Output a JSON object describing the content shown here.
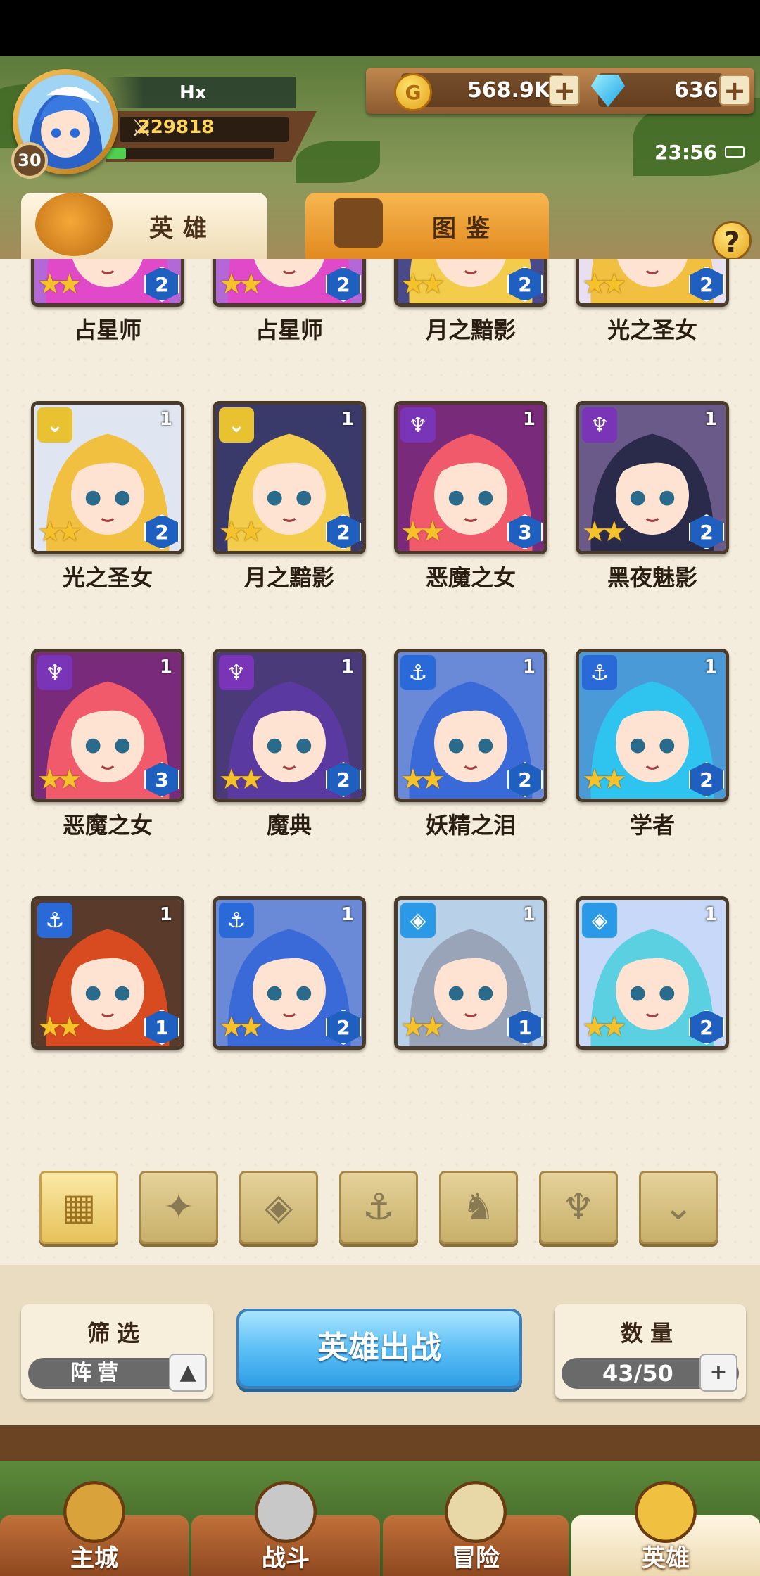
{
  "player": {
    "name": "Hx",
    "level": "30",
    "power": "229818",
    "exp_fraction": 0.12
  },
  "currency": {
    "gold": "568.9K",
    "gems": "636",
    "gold_symbol": "G"
  },
  "status": {
    "time": "23:56"
  },
  "tabs": {
    "heroes": "英雄",
    "codex": "图鉴",
    "help": "?"
  },
  "heroes": [
    {
      "name": "占星师",
      "faction": "light",
      "count": "",
      "stars": 2,
      "tier": "2",
      "hair": "#e04ac8",
      "bg": "#b468d8"
    },
    {
      "name": "占星师",
      "faction": "light",
      "count": "",
      "stars": 2,
      "tier": "2",
      "hair": "#e04ac8",
      "bg": "#b468d8"
    },
    {
      "name": "月之黯影",
      "faction": "light",
      "count": "",
      "stars": 2,
      "tier": "2",
      "hair": "#f2cc4a",
      "bg": "#4a4a8a"
    },
    {
      "name": "光之圣女",
      "faction": "light",
      "count": "",
      "stars": 2,
      "tier": "2",
      "hair": "#f2c040",
      "bg": "#e8e0f0"
    },
    {
      "name": "光之圣女",
      "faction": "light",
      "count": "1",
      "stars": 2,
      "tier": "2",
      "hair": "#f2c040",
      "bg": "#dfe6f2"
    },
    {
      "name": "月之黯影",
      "faction": "light",
      "count": "1",
      "stars": 2,
      "tier": "2",
      "hair": "#f2cc4a",
      "bg": "#3a3a6a"
    },
    {
      "name": "恶魔之女",
      "faction": "demon",
      "count": "1",
      "stars": 2,
      "tier": "3",
      "hair": "#f05a6a",
      "bg": "#7a2a7a"
    },
    {
      "name": "黑夜魅影",
      "faction": "demon",
      "count": "1",
      "stars": 2,
      "tier": "2",
      "hair": "#2a2a4a",
      "bg": "#6a5a8a"
    },
    {
      "name": "恶魔之女",
      "faction": "demon",
      "count": "1",
      "stars": 2,
      "tier": "3",
      "hair": "#f05a6a",
      "bg": "#7a2a7a"
    },
    {
      "name": "魔典",
      "faction": "demon",
      "count": "1",
      "stars": 2,
      "tier": "2",
      "hair": "#5a3aa0",
      "bg": "#4a3a7a"
    },
    {
      "name": "妖精之泪",
      "faction": "sea",
      "count": "1",
      "stars": 2,
      "tier": "2",
      "hair": "#3a6ad8",
      "bg": "#6a8ad8"
    },
    {
      "name": "学者",
      "faction": "sea",
      "count": "1",
      "stars": 2,
      "tier": "2",
      "hair": "#2fc4f0",
      "bg": "#4a9ad8"
    },
    {
      "name": "",
      "faction": "sea",
      "count": "1",
      "stars": 2,
      "tier": "1",
      "hair": "#d84a20",
      "bg": "#5a3a2a"
    },
    {
      "name": "",
      "faction": "sea",
      "count": "1",
      "stars": 2,
      "tier": "2",
      "hair": "#3a6ad8",
      "bg": "#6a8ad8"
    },
    {
      "name": "",
      "faction": "ice",
      "count": "1",
      "stars": 2,
      "tier": "1",
      "hair": "#9aa4b8",
      "bg": "#b8d0e8"
    },
    {
      "name": "",
      "faction": "ice",
      "count": "1",
      "stars": 2,
      "tier": "2",
      "hair": "#5ad0e0",
      "bg": "#c8d8f8"
    }
  ],
  "faction_filters": [
    {
      "icon": "all-grid-icon",
      "active": true
    },
    {
      "icon": "leaf-faction-icon",
      "active": false
    },
    {
      "icon": "crystal-faction-icon",
      "active": false
    },
    {
      "icon": "anchor-faction-icon",
      "active": false
    },
    {
      "icon": "beast-faction-icon",
      "active": false
    },
    {
      "icon": "demon-faction-icon",
      "active": false
    },
    {
      "icon": "light-faction-icon",
      "active": false
    }
  ],
  "controls": {
    "filter_title": "筛选",
    "filter_value": "阵营",
    "deploy_label": "英雄出战",
    "count_title": "数量",
    "count_value": "43/50"
  },
  "nav": [
    {
      "label": "主城",
      "active": false
    },
    {
      "label": "战斗",
      "active": false
    },
    {
      "label": "冒险",
      "active": false
    },
    {
      "label": "英雄",
      "active": true
    }
  ],
  "colors": {
    "faction_light": "#e8c230",
    "faction_demon": "#7a34b8",
    "faction_sea": "#2a6ad8",
    "faction_ice": "#2a9ae8",
    "tier": "#1f5fbf"
  }
}
